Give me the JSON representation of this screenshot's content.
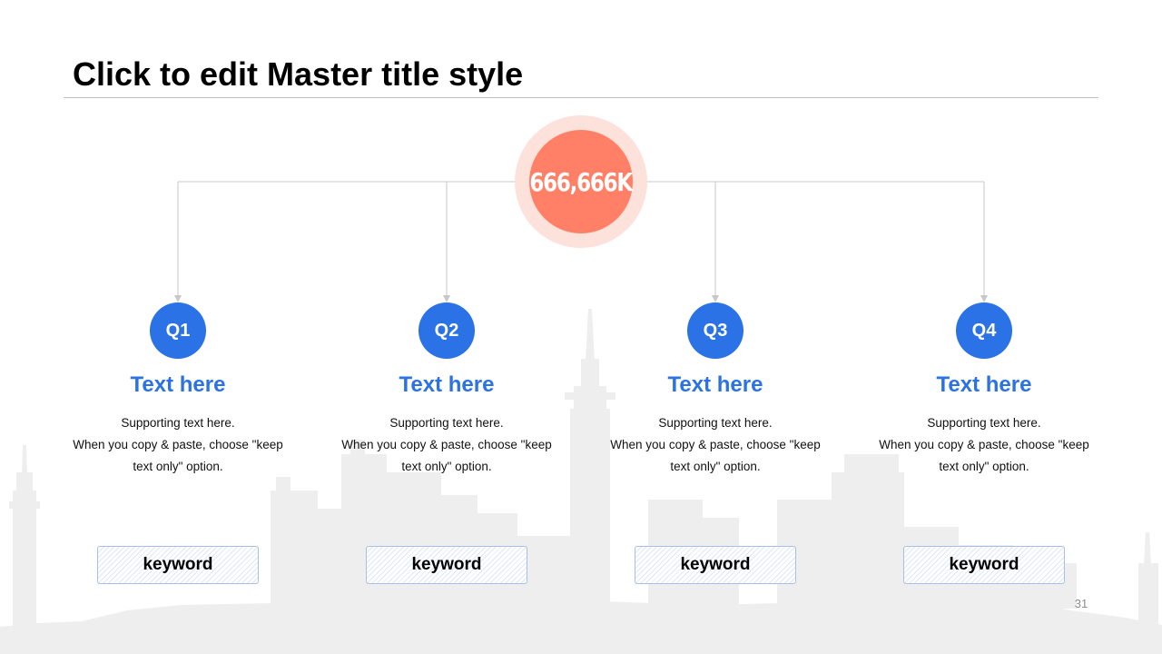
{
  "slide": {
    "title": "Click to edit Master title style",
    "page_number": "31"
  },
  "hub": {
    "value": "666,666K"
  },
  "columns": [
    {
      "badge": "Q1",
      "heading": "Text here",
      "body_lines": [
        "Supporting  text here.",
        "When  you copy & paste, choose \"keep",
        "text only\" option."
      ],
      "keyword": "keyword"
    },
    {
      "badge": "Q2",
      "heading": "Text here",
      "body_lines": [
        "Supporting  text here.",
        "When  you copy & paste, choose \"keep",
        "text only\" option."
      ],
      "keyword": "keyword"
    },
    {
      "badge": "Q3",
      "heading": "Text here",
      "body_lines": [
        "Supporting  text here.",
        "When  you copy & paste, choose \"keep",
        "text only\" option."
      ],
      "keyword": "keyword"
    },
    {
      "badge": "Q4",
      "heading": "Text here",
      "body_lines": [
        "Supporting  text here.",
        "When  you copy & paste, choose \"keep",
        "text only\" option."
      ],
      "keyword": "keyword"
    }
  ],
  "colors": {
    "accent": "#2a72e6",
    "hub": "#ff8066",
    "hub_ring": "#fde2dc",
    "connector": "#c8c8c8",
    "skyline": "#eeeeee",
    "keyword_border": "#a9bfe8"
  }
}
